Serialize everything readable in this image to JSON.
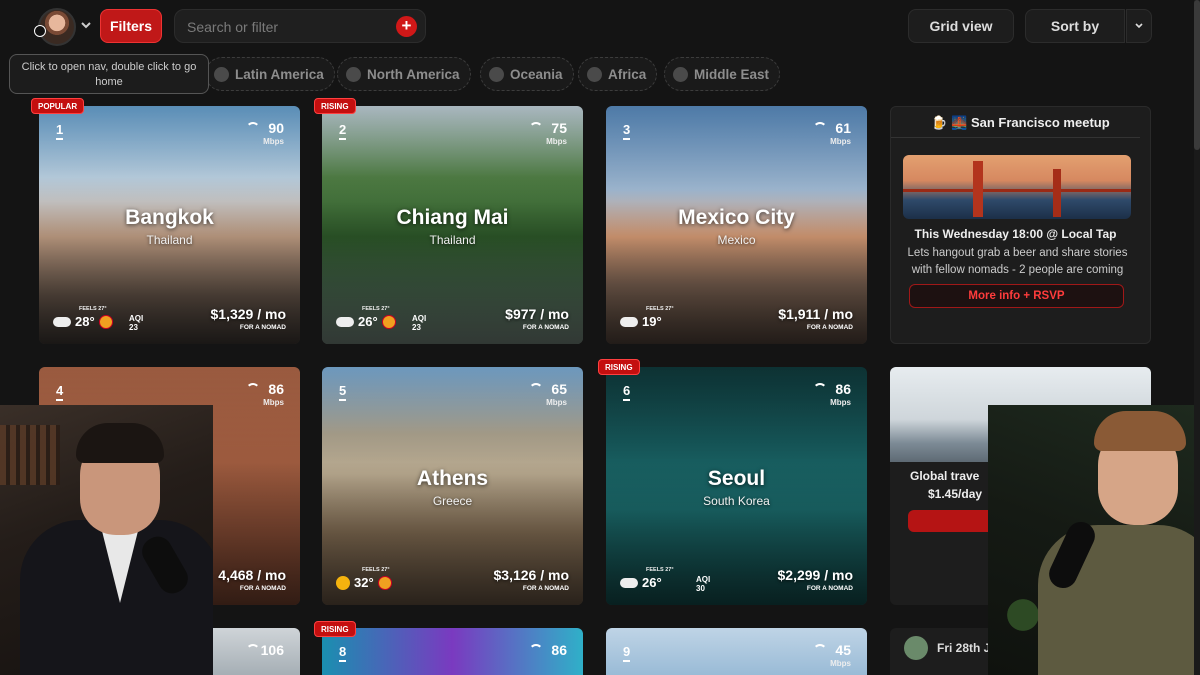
{
  "topbar": {
    "filters_label": "Filters",
    "search_placeholder": "Search or filter",
    "grid_view_label": "Grid view",
    "sort_label": "Sort by"
  },
  "tooltip": {
    "text": "Click to open nav, double click to go home"
  },
  "regions": [
    {
      "label": "Latin America"
    },
    {
      "label": "North America"
    },
    {
      "label": "Oceania"
    },
    {
      "label": "Africa"
    },
    {
      "label": "Middle East"
    }
  ],
  "cities": [
    {
      "rank": "1",
      "name": "Bangkok",
      "country": "Thailand",
      "mbps": "90",
      "price": "$1,329 / mo",
      "temp": "28°",
      "aqi": "23",
      "badge": "POPULAR"
    },
    {
      "rank": "2",
      "name": "Chiang Mai",
      "country": "Thailand",
      "mbps": "75",
      "price": "$977 / mo",
      "temp": "26°",
      "aqi": "23",
      "badge": "RISING"
    },
    {
      "rank": "3",
      "name": "Mexico City",
      "country": "Mexico",
      "mbps": "61",
      "price": "$1,911 / mo",
      "temp": "19°",
      "aqi": "",
      "badge": ""
    },
    {
      "rank": "4",
      "name": "",
      "country": "",
      "mbps": "86",
      "price": "4,468 / mo",
      "temp": "",
      "aqi": "",
      "badge": ""
    },
    {
      "rank": "5",
      "name": "Athens",
      "country": "Greece",
      "mbps": "65",
      "price": "$3,126 / mo",
      "temp": "32°",
      "aqi": "",
      "badge": ""
    },
    {
      "rank": "6",
      "name": "Seoul",
      "country": "South Korea",
      "mbps": "86",
      "price": "$2,299 / mo",
      "temp": "26°",
      "aqi": "30",
      "badge": "RISING"
    },
    {
      "rank": "",
      "name": "",
      "country": "",
      "mbps": "106",
      "price": "",
      "temp": "",
      "aqi": "",
      "badge": ""
    },
    {
      "rank": "8",
      "name": "",
      "country": "",
      "mbps": "86",
      "price": "",
      "temp": "",
      "aqi": "",
      "badge": "RISING"
    },
    {
      "rank": "9",
      "name": "",
      "country": "",
      "mbps": "45",
      "price": "",
      "temp": "",
      "aqi": "",
      "badge": ""
    }
  ],
  "labels": {
    "mbps_unit": "Mbps",
    "for_a_nomad": "FOR A NOMAD",
    "feels": "FEELS 27°",
    "aqi": "AQI"
  },
  "meetup": {
    "title": "🍺 🌉 San Francisco meetup",
    "when": "This Wednesday 18:00 @ Local Tap",
    "description": "Lets hangout grab a beer and share stories with fellow nomads - 2 people are coming",
    "button": "More info + RSVP"
  },
  "ad": {
    "title": "Global trave",
    "price": "$1.45/day"
  },
  "datecard": {
    "text": "Fri 28th J"
  },
  "colors": {
    "accent": "#c01818",
    "background": "#141414",
    "card": "#1d1d1d"
  }
}
